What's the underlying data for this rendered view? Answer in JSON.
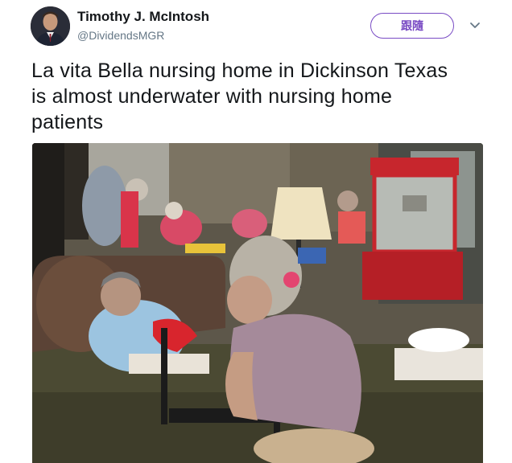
{
  "user": {
    "name": "Timothy J. McIntosh",
    "handle": "@DividendsMGR",
    "avatar_icon": "profile-photo"
  },
  "actions": {
    "follow_label": "跟隨",
    "menu_icon": "chevron-down-icon"
  },
  "tweet": {
    "lines": [
      "La vita Bella nursing home in Dickinson Texas",
      "is almost underwater with nursing home",
      "patients"
    ]
  },
  "colors": {
    "accent": "#794bc4",
    "text": "#14171a",
    "secondary": "#657786"
  }
}
